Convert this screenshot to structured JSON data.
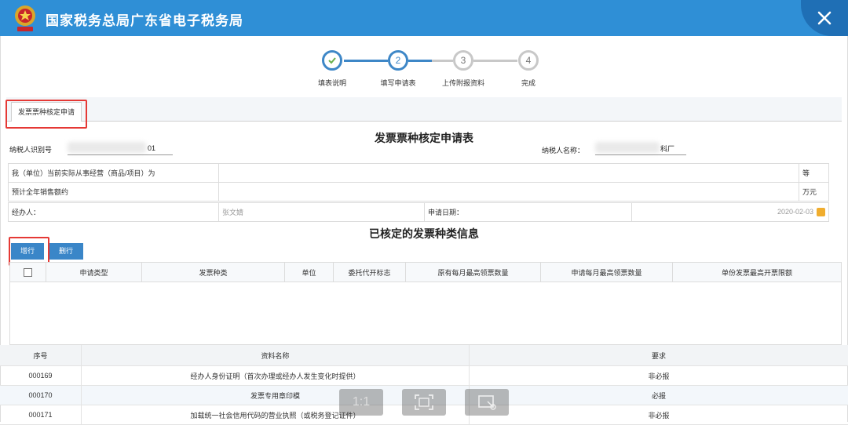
{
  "header": {
    "title": "国家税务总局广东省电子税务局",
    "logo_text": "税"
  },
  "steps": [
    {
      "num": "✓",
      "label": "填表说明",
      "state": "done"
    },
    {
      "num": "2",
      "label": "填写申请表",
      "state": "active"
    },
    {
      "num": "3",
      "label": "上传附报资料",
      "state": "todo"
    },
    {
      "num": "4",
      "label": "完成",
      "state": "todo"
    }
  ],
  "tab": {
    "label": "发票票种核定申请"
  },
  "form": {
    "title": "发票票种核定申请表",
    "taxpayer_id_label": "纳税人识别号",
    "taxpayer_id_tail": "01",
    "taxpayer_name_label": "纳税人名称：",
    "taxpayer_name_tail": "科厂",
    "row1_label": "我（单位）当前实际从事经营（商品/项目）为",
    "row1_unit": "等",
    "row2_label": "预计全年销售额约",
    "row2_unit": "万元",
    "agent_label": "经办人：",
    "agent_value": "张文婧",
    "date_label": "申请日期：",
    "date_value": "2020-02-03"
  },
  "grid": {
    "title": "已核定的发票种类信息",
    "add_label": "增行",
    "delete_label": "删行",
    "columns": [
      "申请类型",
      "发票种类",
      "单位",
      "委托代开标志",
      "原有每月最高领票数量",
      "申请每月最高领票数量",
      "单份发票最高开票限额"
    ]
  },
  "materials": {
    "columns": [
      "序号",
      "资料名称",
      "要求"
    ],
    "rows": [
      {
        "id": "000169",
        "name": "经办人身份证明（首次办理或经办人发生变化时提供）",
        "req": "非必报"
      },
      {
        "id": "000170",
        "name": "发票专用章印模",
        "req": "必报"
      },
      {
        "id": "000171",
        "name": "加载统一社会信用代码的营业执照（或税务登记证件）",
        "req": "非必报"
      }
    ]
  },
  "viewer": {
    "actual_size": "1:1"
  },
  "colors": {
    "header": "#2f8fd6",
    "accent": "#3a86c8",
    "highlight": "#e53935"
  }
}
